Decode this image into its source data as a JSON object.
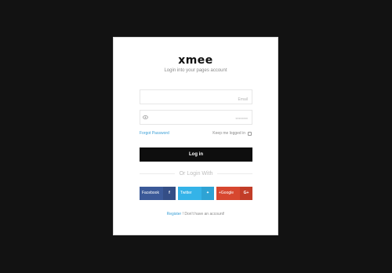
{
  "logo": {
    "text": "xmee"
  },
  "subtitle": "Login into your pages account",
  "email_field": {
    "placeholder": "Email",
    "value": ""
  },
  "password_field": {
    "placeholder": "********",
    "value": ""
  },
  "forgot_password": "Forgot Password",
  "keep_logged_in": {
    "label": "Keep me logged in",
    "checked": false
  },
  "login_button": "Log in",
  "divider_text": "Or Login With",
  "social": {
    "facebook": {
      "label": "Facebook",
      "icon": "f",
      "color": "#3b5998"
    },
    "twitter": {
      "label": "Twitter",
      "icon": "✦",
      "color": "#34b3e8"
    },
    "google": {
      "label": "+Google",
      "icon": "G+",
      "color": "#d7472f"
    }
  },
  "register": {
    "link": "Register",
    "text": "! Don't have an account!"
  }
}
